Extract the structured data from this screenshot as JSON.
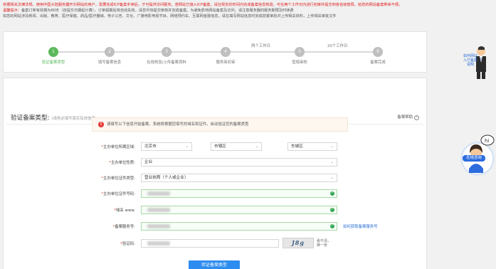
{
  "notice": {
    "line1": "依据相关法律法规，使用中国大陆服务器开办网站的用户，需要完成ICP备案手续后，才可提供访问服务。若网站已接入ICP备案，请在规定的时间内完成备案信息核验，可在两个工作日内进行初审并提交到各省级管局，给您的网站备案带来不便。",
    "line2_prefix": "温馨提示：",
    "line2": "备案订单有效期为60天（自提交日期起计算），订单超期后将自动失效，请您尽快提交审核并完成备案。为避免影响网站备案及访问，请注意服务器的服务期限及时续费",
    "line3": "如您的网站涉及新闻、出版、教育、医疗保健、药品/医疗器械、电子公告、文化、广播电影电视节目、网络预约车、互联网金融信息，请在填写网站信息时完成前置审批并上传相关资料，上传相关审批文件"
  },
  "steps": [
    {
      "num": "1",
      "label": "验证备案类型",
      "active": true
    },
    {
      "num": "2",
      "label": "填写备案信息",
      "active": false
    },
    {
      "num": "3",
      "label": "在线核验/上传备案资料",
      "active": false
    },
    {
      "num": "4",
      "label": "服务商初审",
      "active": false
    },
    {
      "num": "5",
      "label": "管局审核",
      "active": false
    },
    {
      "num": "6",
      "label": "备案完成",
      "active": false
    }
  ],
  "span_labels": {
    "review_time": "两个工作日",
    "bureau_time": "20个工作日"
  },
  "main": {
    "title": "验证备案类型:",
    "subtitle": "(请务必填写真实有效信息)",
    "help": "备案帮助",
    "help_icon": "question-circle-icon",
    "tip": "请填写以下信息开始备案，系统将根据您填写的域名和证件，自动验证您的备案类型"
  },
  "form": {
    "region": {
      "label": "主办单位所属区域:",
      "province": "北京市",
      "city": "市辖区",
      "district": "东城区"
    },
    "unit_type": {
      "label": "主办单位性质:",
      "value": "企业"
    },
    "cert_type": {
      "label": "主办单位证件类型:",
      "value": "营业执照（个人或企业）"
    },
    "cert_no": {
      "label": "主办单位证件号码:"
    },
    "domain": {
      "label": "域名",
      "prefix": "www."
    },
    "service_no": {
      "label": "备案服务号:",
      "link": "如何获取备案服务号"
    },
    "captcha": {
      "label": "验证码:",
      "image_text": "J8g",
      "refresh": "看不清，换一张"
    },
    "submit": "验证备案类型"
  },
  "floats": {
    "agent_title": "如何网站入已备案说明",
    "consult": "在线咨询"
  },
  "colors": {
    "accent": "#2d8cf0",
    "success": "#5cb85c",
    "danger": "#e53935",
    "step_inactive": "#bfbfbf"
  }
}
